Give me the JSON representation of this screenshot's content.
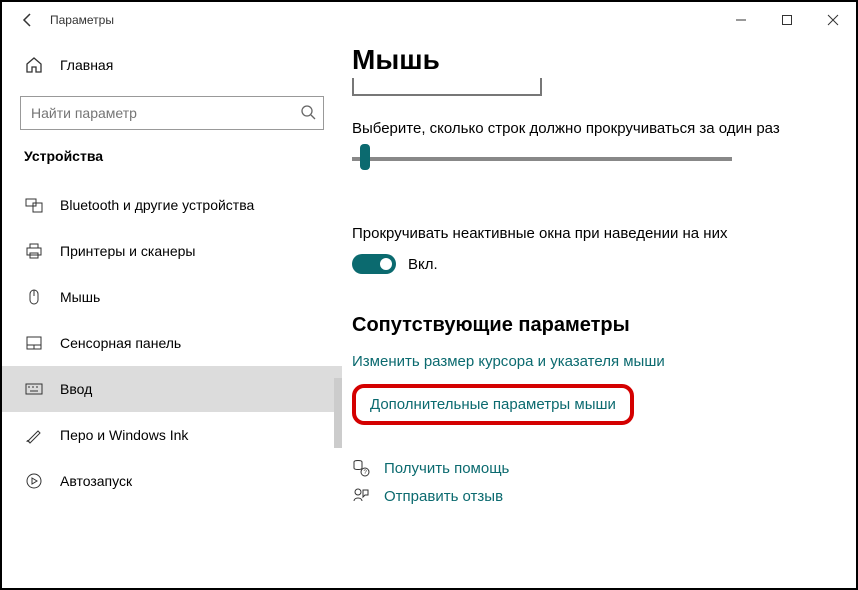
{
  "titlebar": {
    "title": "Параметры"
  },
  "sidebar": {
    "home": "Главная",
    "search_placeholder": "Найти параметр",
    "category": "Устройства",
    "items": [
      {
        "label": "Bluetooth и другие устройства"
      },
      {
        "label": "Принтеры и сканеры"
      },
      {
        "label": "Мышь"
      },
      {
        "label": "Сенсорная панель"
      },
      {
        "label": "Ввод"
      },
      {
        "label": "Перо и Windows Ink"
      },
      {
        "label": "Автозапуск"
      }
    ]
  },
  "main": {
    "heading": "Мышь",
    "scroll_desc": "Выберите, сколько строк должно прокручиваться за один раз",
    "inactive_desc": "Прокручивать неактивные окна при наведении на них",
    "toggle_label": "Вкл.",
    "related_heading": "Сопутствующие параметры",
    "link_cursor": "Изменить размер курсора и указателя мыши",
    "link_advanced": "Дополнительные параметры мыши",
    "help": "Получить помощь",
    "feedback": "Отправить отзыв"
  }
}
